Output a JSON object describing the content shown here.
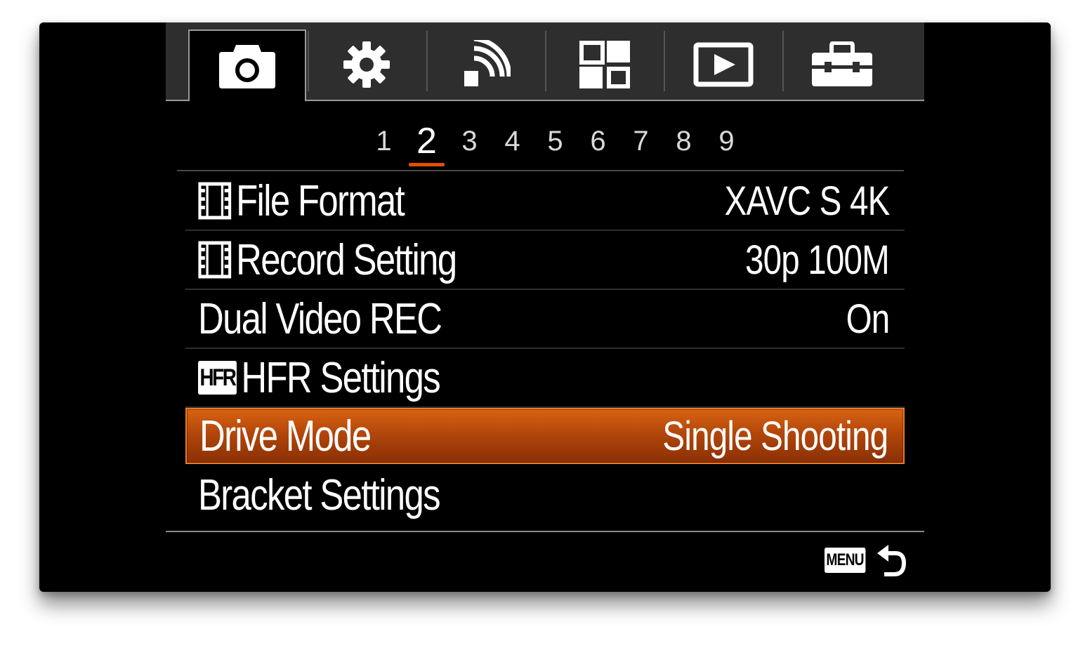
{
  "tabs": [
    {
      "icon": "camera-icon",
      "active": true
    },
    {
      "icon": "gear-icon",
      "active": false
    },
    {
      "icon": "network-icon",
      "active": false
    },
    {
      "icon": "application-icon",
      "active": false
    },
    {
      "icon": "playback-icon",
      "active": false
    },
    {
      "icon": "toolbox-icon",
      "active": false
    }
  ],
  "pages": [
    "1",
    "2",
    "3",
    "4",
    "5",
    "6",
    "7",
    "8",
    "9"
  ],
  "active_page": "2",
  "menu": {
    "items": [
      {
        "label": "File Format",
        "value": "XAVC S 4K",
        "icon": "movie-icon"
      },
      {
        "label": "Record Setting",
        "value": "30p 100M",
        "icon": "movie-icon"
      },
      {
        "label": "Dual Video REC",
        "value": "On",
        "icon": ""
      },
      {
        "label": "HFR Settings",
        "value": "",
        "icon": "hfr-icon",
        "icon_text": "HFR"
      },
      {
        "label": "Drive Mode",
        "value": "Single Shooting",
        "icon": "",
        "selected": true
      },
      {
        "label": "Bracket Settings",
        "value": "",
        "icon": ""
      }
    ]
  },
  "footer": {
    "menu_label": "MENU",
    "back_icon": "back-arrow-icon"
  },
  "colors": {
    "highlight": "#c2500c",
    "highlight_border": "#f07a20",
    "page_underline": "#e15000",
    "tabbar": "#2e2e2e"
  }
}
